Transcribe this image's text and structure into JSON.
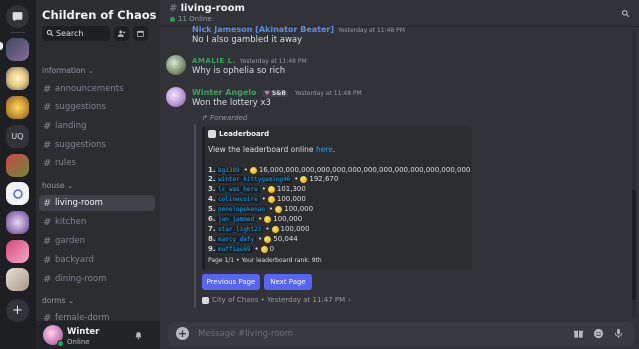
{
  "guild": {
    "name": "Children of Chaos",
    "search_label": "Search"
  },
  "rail": {
    "uq_label": "UQ"
  },
  "categories": {
    "information": "information",
    "house": "house",
    "dorms": "dorms"
  },
  "channels": {
    "information": [
      "announcements",
      "suggestions",
      "landing",
      "suggestions",
      "rules"
    ],
    "house": [
      "living-room",
      "kitchen",
      "garden",
      "backyard",
      "dining-room"
    ],
    "dorms": [
      "female-dorm"
    ]
  },
  "user": {
    "name": "Winter",
    "status": "Online"
  },
  "header": {
    "channel": "living-room",
    "online": "11 Online"
  },
  "messages": [
    {
      "author": "Nick Jameson [Akinator Beater]",
      "time": "Yesterday at 11:48 PM",
      "text": "No I also gambled it away",
      "color": "#5c8fdb"
    },
    {
      "author": "AMALIE L.",
      "time": "Yesterday at 11:48 PM",
      "text": "Why is ophelia so rich",
      "color": "#3ba55c"
    },
    {
      "author": "Winter Angelo",
      "badge": "S&B",
      "time": "Yesterday at 11:48 PM",
      "text": "Won the lottery x3",
      "color": "#3ba55c"
    }
  ],
  "forward": {
    "label": "Forwarded",
    "embed": {
      "author": "Leaderboard",
      "desc_prefix": "View the leaderboard online ",
      "desc_link": "here",
      "desc_suffix": ".",
      "rows": [
        {
          "rank": "1.",
          "user": "bg1389",
          "amount": "16,000,000,000,000,000,000,000,000,000,000,000,000,000"
        },
        {
          "rank": "2.",
          "user": "winter_kittygaming46",
          "amount": "192,670"
        },
        {
          "rank": "3.",
          "user": "lc_was_here",
          "amount": "101,300"
        },
        {
          "rank": "4.",
          "user": "colinecoire",
          "amount": "100,000"
        },
        {
          "rank": "5.",
          "user": "penelopekenan",
          "amount": "100,000"
        },
        {
          "rank": "6.",
          "user": "jun_jammed",
          "amount": "100,000"
        },
        {
          "rank": "7.",
          "user": "star_light23",
          "amount": "100,000"
        },
        {
          "rank": "8.",
          "user": "marcy_dafy",
          "amount": "50,044"
        },
        {
          "rank": "9.",
          "user": "muffias69",
          "amount": "0"
        }
      ],
      "footer": "Page 1/1 • Your leaderboard rank: 9th"
    },
    "buttons": {
      "prev": "Previous Page",
      "next": "Next Page"
    },
    "origin": "City of Chaos • Yesterday at 11:47 PM"
  },
  "composer": {
    "placeholder": "Message #living-room"
  },
  "colors": {
    "blurple": "#5865f2",
    "online": "#23a559",
    "link": "#00a8fc"
  }
}
